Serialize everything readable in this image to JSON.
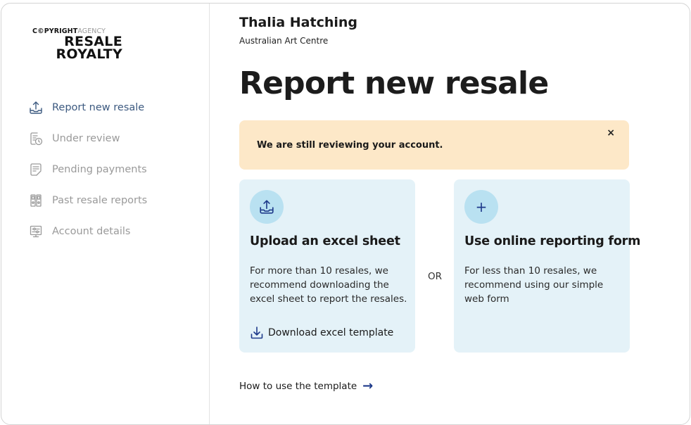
{
  "brand": {
    "top_bold_1": "C",
    "top_bold_2": "PYRIGHT",
    "top_grey": "AGENCY",
    "line1": "RESALE",
    "line2": "ROYALTY"
  },
  "sidebar": {
    "items": [
      {
        "label": "Report new resale",
        "icon": "upload-tray-icon",
        "active": true
      },
      {
        "label": "Under review",
        "icon": "document-clock-icon"
      },
      {
        "label": "Pending payments",
        "icon": "document-edit-icon"
      },
      {
        "label": "Past resale reports",
        "icon": "binders-icon"
      },
      {
        "label": "Account details",
        "icon": "settings-sliders-icon"
      }
    ]
  },
  "user": {
    "name": "Thalia Hatching",
    "organisation": "Australian Art Centre"
  },
  "page": {
    "title": "Report new resale"
  },
  "alert": {
    "message": "We are still reviewing your account.",
    "close": "×"
  },
  "cards": {
    "upload": {
      "title": "Upload an excel sheet",
      "description": "For more than 10 resales, we recommend downloading the excel sheet to report the resales.",
      "link": "Download excel template"
    },
    "online": {
      "icon_glyph": "+",
      "title": "Use online reporting form",
      "description": "For less than 10 resales, we recommend using our simple web form"
    },
    "separator": "OR"
  },
  "help": {
    "label": "How to use the template",
    "arrow": "→"
  },
  "colors": {
    "accent": "#1e3a8a",
    "active_nav": "#3d5a80",
    "alert_bg": "#fde8c8",
    "card_bg": "#e4f2f8",
    "icon_circle": "#b9e1f1"
  }
}
